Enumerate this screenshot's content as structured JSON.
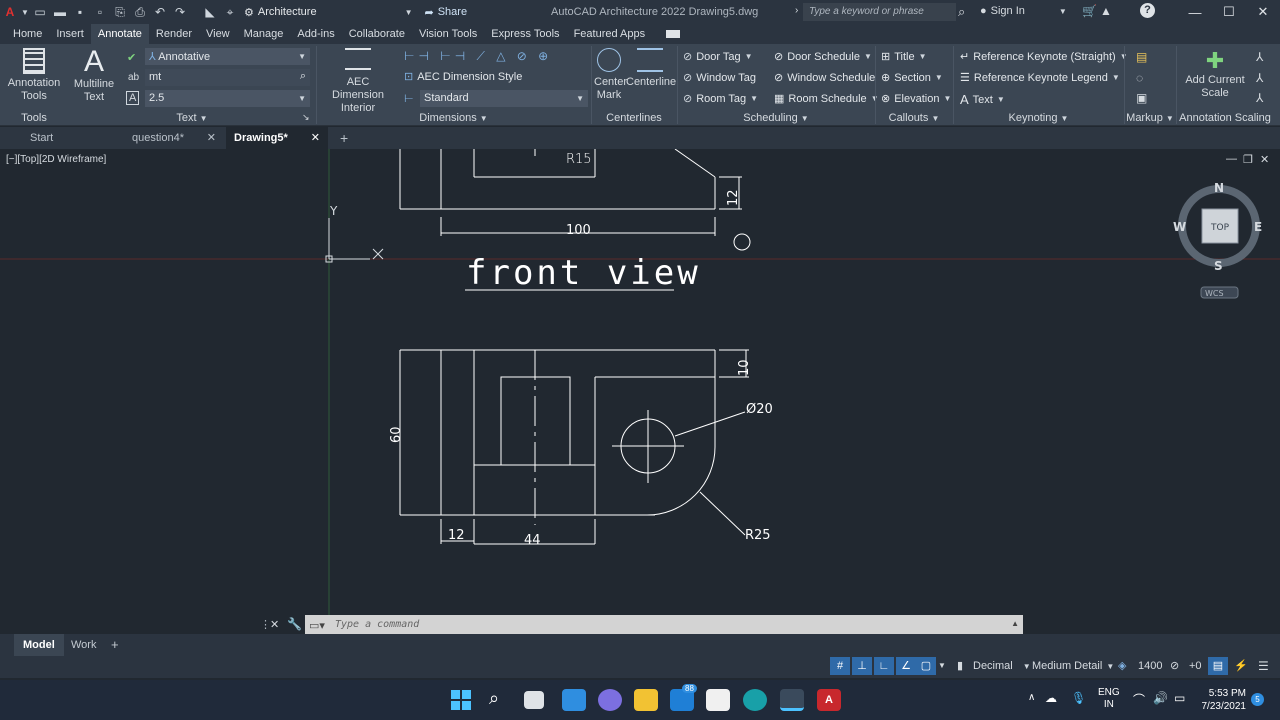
{
  "titlebar": {
    "workspace": "Architecture",
    "share": "Share",
    "app_title": "AutoCAD Architecture 2022   Drawing5.dwg",
    "search_placeholder": "Type a keyword or phrase",
    "sign_in": "Sign In"
  },
  "ribbon_tabs": [
    "Home",
    "Insert",
    "Annotate",
    "Render",
    "View",
    "Manage",
    "Add-ins",
    "Collaborate",
    "Vision Tools",
    "Express Tools",
    "Featured Apps"
  ],
  "ribbon": {
    "annotation_tools": "Annotation Tools",
    "multiline_text": "Multiline Text",
    "text_style": "Annotative",
    "text_find": "mt",
    "text_height": "2.5",
    "aec_dimension_interior": "AEC Dimension Interior",
    "aec_dimension_style": "AEC Dimension Style",
    "dim_style_value": "Standard",
    "center_mark": "Center Mark",
    "centerline": "Centerline",
    "door_tag": "Door Tag",
    "window_tag": "Window Tag",
    "room_tag": "Room Tag",
    "door_schedule": "Door Schedule",
    "window_schedule": "Window Schedule",
    "room_schedule": "Room Schedule",
    "title": "Title",
    "section": "Section",
    "elevation": "Elevation",
    "ref_keynote_straight": "Reference Keynote (Straight)",
    "ref_keynote_legend": "Reference Keynote Legend",
    "keynote_text": "Text",
    "add_current_scale": "Add Current Scale",
    "panels": {
      "tools": "Tools",
      "text": "Text",
      "dimensions": "Dimensions",
      "centerlines": "Centerlines",
      "scheduling": "Scheduling",
      "callouts": "Callouts",
      "keynoting": "Keynoting",
      "markup": "Markup",
      "annotation_scaling": "Annotation Scaling"
    }
  },
  "file_tabs": [
    "Start",
    "question4*",
    "Drawing5*"
  ],
  "viewport": {
    "label": "[−][Top][2D Wireframe]",
    "view_title": "front view",
    "dims": {
      "r15": "R15",
      "d12_top": "12",
      "d100": "100",
      "d10": "10",
      "d60": "60",
      "d20": "Ø20",
      "d12_bot": "12",
      "d44": "44",
      "r25": "R25"
    },
    "ucs_y": "Y",
    "viewcube": {
      "n": "N",
      "s": "S",
      "e": "E",
      "w": "W",
      "face": "TOP",
      "wcs": "WCS"
    }
  },
  "command_placeholder": "Type a command",
  "layout_tabs": [
    "Model",
    "Work"
  ],
  "status": {
    "units": "Decimal",
    "detail": "Medium Detail",
    "scale_value": "1400",
    "offset": "+0"
  },
  "taskbar": {
    "lang": "ENG",
    "region": "IN",
    "time": "5:53 PM",
    "date": "7/23/2021",
    "badge": "88"
  }
}
